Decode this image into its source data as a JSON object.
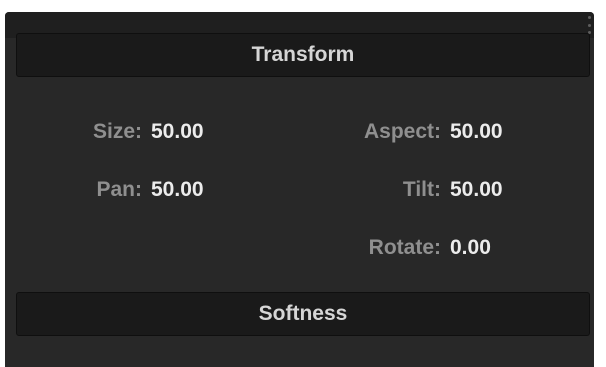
{
  "panel": {
    "menu_icon": "kebab-vertical-icon"
  },
  "sections": {
    "transform_label": "Transform",
    "softness_label": "Softness"
  },
  "params": {
    "size": {
      "label": "Size:",
      "value": "50.00"
    },
    "aspect": {
      "label": "Aspect:",
      "value": "50.00"
    },
    "pan": {
      "label": "Pan:",
      "value": "50.00"
    },
    "tilt": {
      "label": "Tilt:",
      "value": "50.00"
    },
    "rotate": {
      "label": "Rotate:",
      "value": "0.00"
    }
  },
  "colors": {
    "panel_bg": "#282828",
    "header_bg": "#1a1a1a",
    "label": "#8f8f8f",
    "value": "#ececec"
  }
}
